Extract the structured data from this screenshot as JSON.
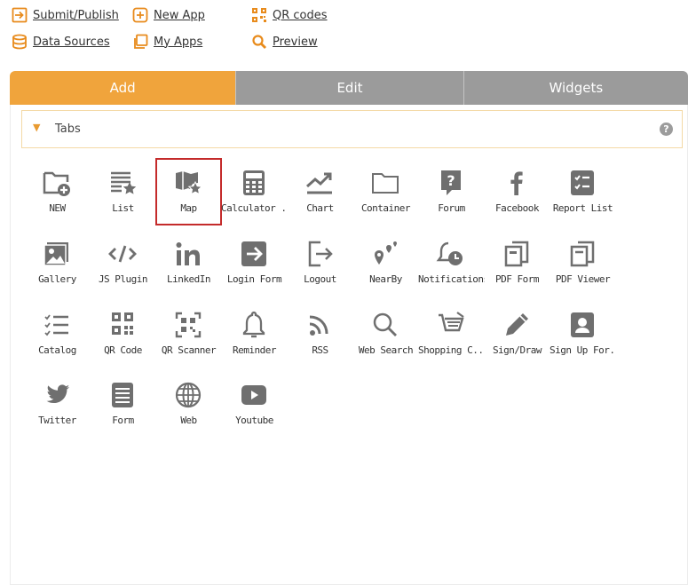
{
  "toplinks": {
    "submit": "Submit/Publish",
    "new_app": "New App",
    "qr_codes": "QR codes",
    "data_sources": "Data Sources",
    "my_apps": "My Apps",
    "preview": "Preview"
  },
  "tabs": {
    "add": "Add",
    "edit": "Edit",
    "widgets": "Widgets"
  },
  "group": {
    "title": "Tabs",
    "help": "?"
  },
  "widgets": [
    {
      "label": "NEW",
      "icon": "new-folder-icon"
    },
    {
      "label": "List",
      "icon": "list-icon"
    },
    {
      "label": "Map",
      "icon": "map-icon",
      "selected": true
    },
    {
      "label": "Calculator ...",
      "icon": "calculator-icon"
    },
    {
      "label": "Chart",
      "icon": "chart-icon"
    },
    {
      "label": "Container",
      "icon": "folder-icon"
    },
    {
      "label": "Forum",
      "icon": "forum-icon"
    },
    {
      "label": "Facebook",
      "icon": "facebook-icon"
    },
    {
      "label": "Report List",
      "icon": "report-list-icon"
    },
    {
      "label": "Gallery",
      "icon": "gallery-icon"
    },
    {
      "label": "JS Plugin",
      "icon": "code-icon"
    },
    {
      "label": "LinkedIn",
      "icon": "linkedin-icon"
    },
    {
      "label": "Login Form",
      "icon": "login-icon"
    },
    {
      "label": "Logout",
      "icon": "logout-icon"
    },
    {
      "label": "NearBy",
      "icon": "nearby-icon"
    },
    {
      "label": "Notifications",
      "icon": "bell-clock-icon"
    },
    {
      "label": "PDF Form",
      "icon": "pdf-form-icon"
    },
    {
      "label": "PDF Viewer",
      "icon": "pdf-viewer-icon"
    },
    {
      "label": "Catalog",
      "icon": "catalog-icon"
    },
    {
      "label": "QR Code",
      "icon": "qr-code-icon"
    },
    {
      "label": "QR Scanner",
      "icon": "qr-scanner-icon"
    },
    {
      "label": "Reminder",
      "icon": "bell-icon"
    },
    {
      "label": "RSS",
      "icon": "rss-icon"
    },
    {
      "label": "Web Search",
      "icon": "search-icon"
    },
    {
      "label": "Shopping C...",
      "icon": "cart-icon"
    },
    {
      "label": "Sign/Draw",
      "icon": "pencil-icon"
    },
    {
      "label": "Sign Up For...",
      "icon": "user-card-icon"
    },
    {
      "label": "Twitter",
      "icon": "twitter-icon"
    },
    {
      "label": "Form",
      "icon": "form-icon"
    },
    {
      "label": "Web",
      "icon": "globe-icon"
    },
    {
      "label": "Youtube",
      "icon": "youtube-icon"
    }
  ],
  "colors": {
    "accent": "#f0a43c",
    "tab_inactive": "#9b9b9b",
    "icon": "#6f6f6f",
    "selected_border": "#c42b2b"
  }
}
